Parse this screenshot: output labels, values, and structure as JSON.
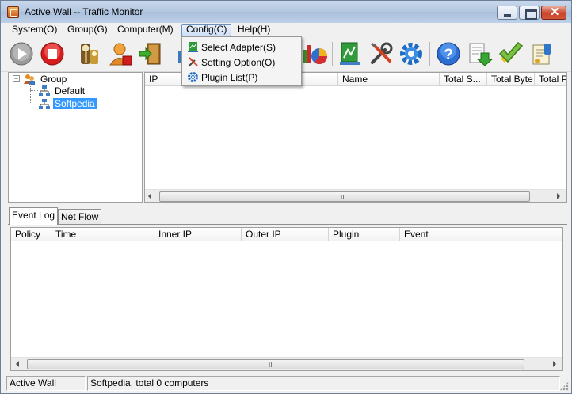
{
  "window": {
    "title": "Active Wall -- Traffic Monitor"
  },
  "menubar": {
    "items": [
      "System(O)",
      "Group(G)",
      "Computer(M)",
      "Config(C)",
      "Help(H)"
    ]
  },
  "config_menu": {
    "items": [
      {
        "label": "Select Adapter(S)",
        "icon": "adapter-icon"
      },
      {
        "label": "Setting Option(O)",
        "icon": "tools-icon"
      },
      {
        "label": "Plugin List(P)",
        "icon": "gear-icon"
      }
    ]
  },
  "toolbar": {
    "buttons": [
      "play-icon",
      "stop-icon",
      "keys-icon",
      "user-icon",
      "door-exit-icon",
      "chart-icon",
      "network-adapter-icon",
      "tools-icon",
      "gear-icon",
      "help-icon",
      "download-icon",
      "checkmark-icon",
      "rules-icon"
    ]
  },
  "tree": {
    "root": "Group",
    "children": [
      "Default",
      "Softpedia"
    ],
    "selected": "Softpedia"
  },
  "computer_list": {
    "columns": [
      "IP",
      "Name",
      "Total S...",
      "Total Byte",
      "Total P"
    ]
  },
  "tabs": {
    "items": [
      "Event Log",
      "Net Flow"
    ],
    "active": "Event Log"
  },
  "event_log": {
    "columns": [
      "Policy",
      "Time",
      "Inner IP",
      "Outer IP",
      "Plugin",
      "Event"
    ]
  },
  "scrollbar": {
    "grip": "III"
  },
  "statusbar": {
    "app": "Active Wall",
    "info": "Softpedia, total 0 computers"
  },
  "colors": {
    "selection": "#3399ff",
    "title_bar": "#b9cce4",
    "window_bg": "#f0f0f0"
  }
}
